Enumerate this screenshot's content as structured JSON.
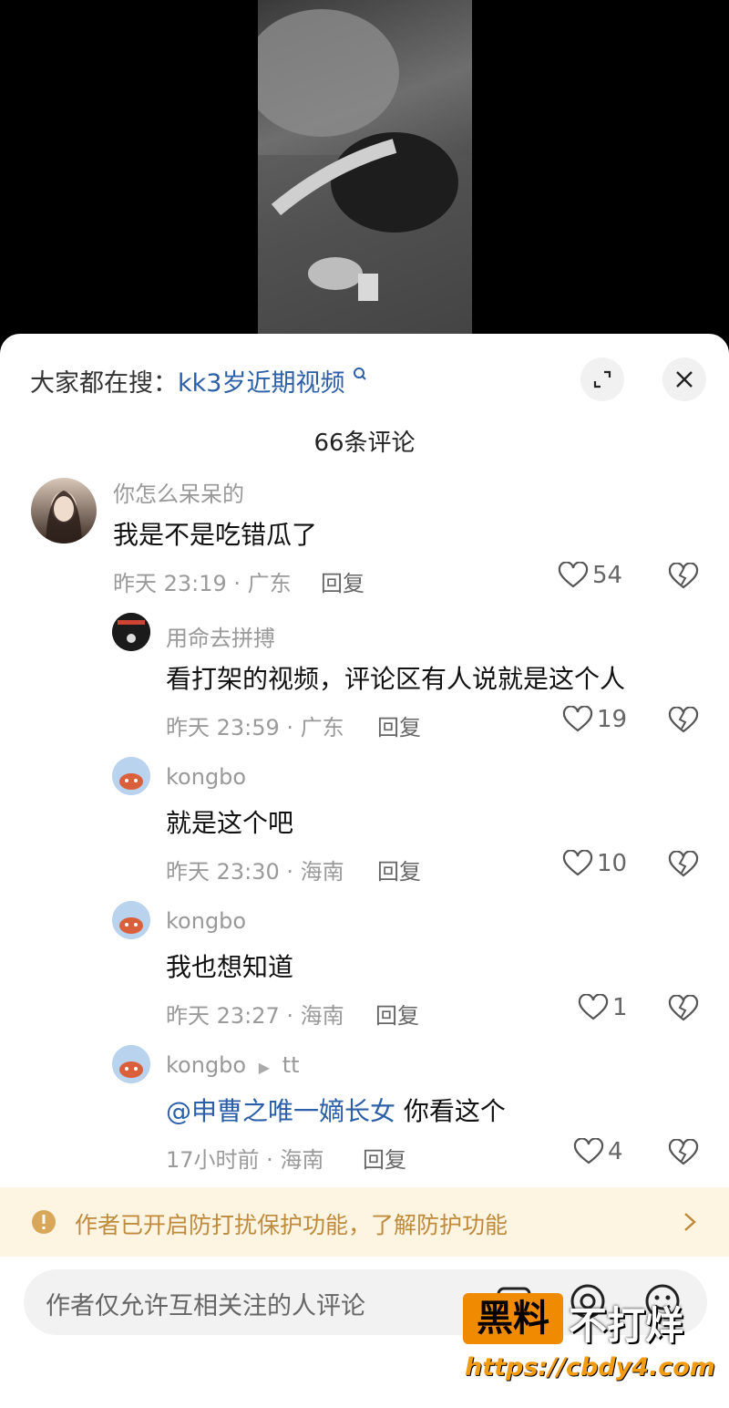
{
  "search": {
    "prefix": "大家都在搜：",
    "keyword": "kk3岁近期视频"
  },
  "comments_count": "66条评论",
  "comments": [
    {
      "user": "你怎么呆呆的",
      "text": "我是不是吃错瓜了",
      "time": "昨天 23:19 · 广东",
      "reply": "回复",
      "likes": "54"
    },
    {
      "user": "用命去拼搏",
      "text": "看打架的视频，评论区有人说就是这个人",
      "time": "昨天 23:59 · 广东",
      "reply": "回复",
      "likes": "19"
    },
    {
      "user": "kongbo",
      "text": "就是这个吧",
      "time": "昨天 23:30 · 海南",
      "reply": "回复",
      "likes": "10"
    },
    {
      "user": "kongbo",
      "text": "我也想知道",
      "time": "昨天 23:27 · 海南",
      "reply": "回复",
      "likes": "1"
    },
    {
      "user": "kongbo",
      "reply_to": "tt",
      "mention": "@申曹之唯一嫡长女",
      "text": " 你看这个",
      "time": "17小时前 · 海南",
      "reply": "回复",
      "likes": "4"
    }
  ],
  "notice": "作者已开启防打扰保护功能，了解防护功能",
  "input_placeholder": "作者仅允许互相关注的人评论",
  "watermark": {
    "brand": "黑料",
    "slogan": "不打烊",
    "url": "https://cbdy4.com"
  },
  "icons": [
    "search-icon",
    "expand-icon",
    "close-icon",
    "heart-icon",
    "broken-heart-icon",
    "warning-icon",
    "chevron-right-icon",
    "image-icon",
    "at-icon",
    "emoji-icon"
  ]
}
